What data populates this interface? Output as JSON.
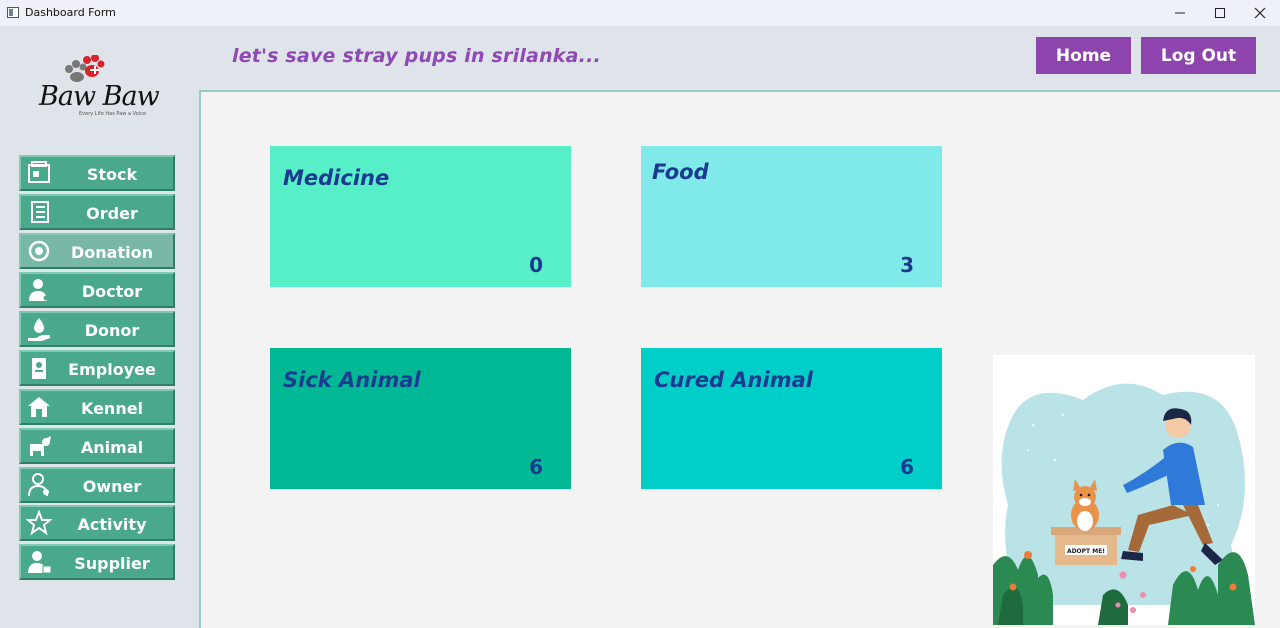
{
  "window": {
    "title": "Dashboard Form"
  },
  "header": {
    "tagline": "let's save stray pups in srilanka...",
    "home_label": "Home",
    "logout_label": "Log Out"
  },
  "logo": {
    "brand": "Baw Baw",
    "slogan": "Every Life Has Paw a Voice"
  },
  "sidebar": {
    "items": [
      {
        "label": "Stock",
        "icon": "stock-icon"
      },
      {
        "label": "Order",
        "icon": "order-icon"
      },
      {
        "label": "Donation",
        "icon": "donation-icon"
      },
      {
        "label": "Doctor",
        "icon": "doctor-icon"
      },
      {
        "label": "Donor",
        "icon": "donor-icon"
      },
      {
        "label": "Employee",
        "icon": "employee-icon"
      },
      {
        "label": "Kennel",
        "icon": "kennel-icon"
      },
      {
        "label": "Animal",
        "icon": "animal-icon"
      },
      {
        "label": "Owner",
        "icon": "owner-icon"
      },
      {
        "label": "Activity",
        "icon": "star-icon"
      },
      {
        "label": "Supplier",
        "icon": "supplier-icon"
      }
    ]
  },
  "cards": {
    "medicine": {
      "title": "Medicine",
      "value": "0",
      "color": "#56efc7"
    },
    "food": {
      "title": "Food",
      "value": "3",
      "color": "#80e9ea"
    },
    "sick": {
      "title": "Sick Animal",
      "value": "6",
      "color": "#00b894"
    },
    "cured": {
      "title": "Cured Animal",
      "value": "6",
      "color": "#00cec9"
    }
  },
  "illustration": {
    "sign_text": "ADOPT ME!"
  },
  "colors": {
    "accent": "#8e44ad",
    "nav": "#4aa98d",
    "card_text": "#1c3a8f"
  }
}
